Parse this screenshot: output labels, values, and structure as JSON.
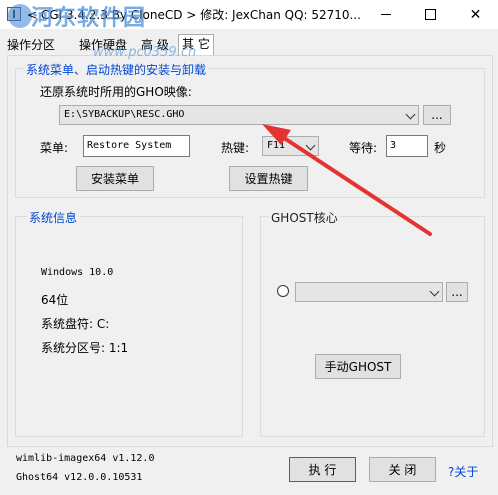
{
  "window": {
    "title": "< CGI 3.4.2.3 By CloneCD > 修改: JexChan  QQ: 52710...",
    "watermark": "河东软件园",
    "watermark_url": "www.pc0359.cn"
  },
  "tabs": [
    "操作分区",
    "操作硬盘",
    "高 级",
    "其 它"
  ],
  "active_tab": 3,
  "menu_group": {
    "title": "系统菜单、启动热键的安装与卸载",
    "gho_label": "还原系统时所用的GHO映像:",
    "gho_path": "E:\\SYBACKUP\\RESC.GHO",
    "browse_label": "...",
    "menu_label": "菜单:",
    "menu_value": "Restore System",
    "hotkey_label": "热键:",
    "hotkey_value": "F11",
    "wait_label": "等待:",
    "wait_value": "3",
    "wait_unit": "秒",
    "install_menu": "安装菜单",
    "set_hotkey": "设置热键"
  },
  "sys_info": {
    "title": "系统信息",
    "os": "Windows 10.0",
    "bits": "64位",
    "sys_drive": "系统盘符: C:",
    "sys_partition": "系统分区号: 1:1"
  },
  "ghost_core": {
    "title": "GHOST核心",
    "browse_label": "...",
    "manual_ghost": "手动GHOST"
  },
  "footer": {
    "wimlib": "wimlib-imagex64 v1.12.0",
    "ghost": "Ghost64 v12.0.0.10531",
    "execute": "执 行",
    "close": "关 闭",
    "about": "?关于"
  },
  "colors": {
    "group_title": "#0046d5",
    "arrow": "#e53333",
    "link": "#0046d5"
  }
}
